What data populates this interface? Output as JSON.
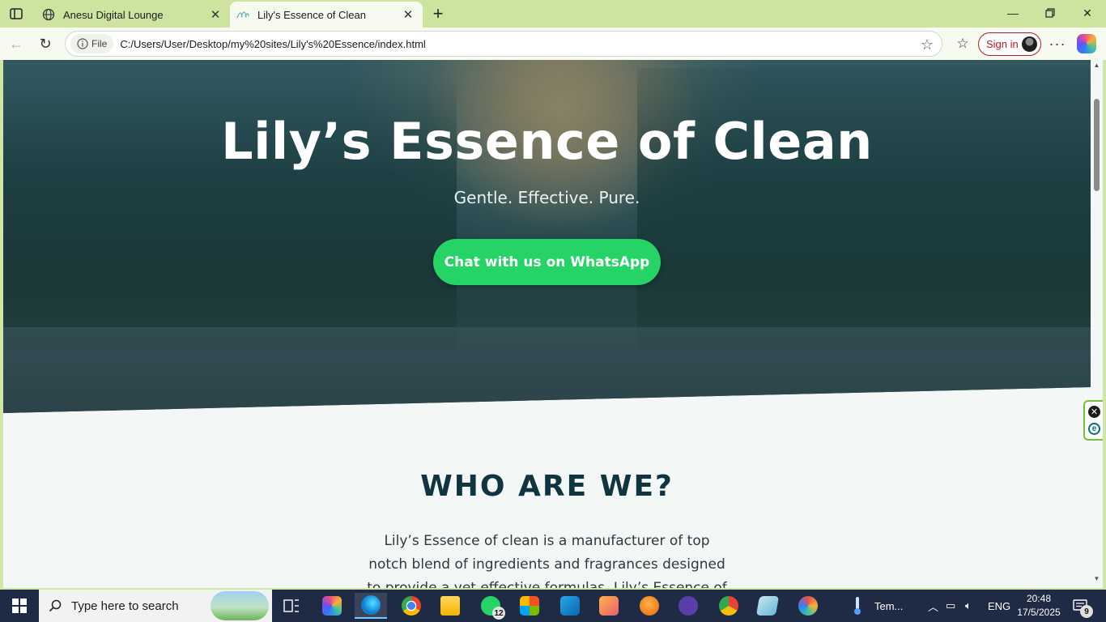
{
  "browser": {
    "tabs": [
      {
        "title": "Anesu Digital Lounge",
        "icon": "globe-icon"
      },
      {
        "title": "Lily's Essence of Clean",
        "icon": "site-favicon"
      }
    ],
    "address": {
      "chip": "File",
      "url": "C:/Users/User/Desktop/my%20sites/Lily's%20Essence/index.html"
    },
    "sign_in_label": "Sign in"
  },
  "page": {
    "hero_title": "Lily’s Essence of Clean",
    "hero_subtitle": "Gentle. Effective. Pure.",
    "cta_label": "Chat with us on WhatsApp",
    "section_title": "WHO ARE WE?",
    "about_text": "Lily’s Essence of clean is a manufacturer of top notch blend of ingredients and fragrances designed to provide a yet effective formulas. Lily’s Essence of Clean products"
  },
  "colors": {
    "cta": "#25d366",
    "section_title": "#123440",
    "browser_frame": "#cde4a1",
    "signin_accent": "#b21d25"
  },
  "taskbar": {
    "search_placeholder": "Type here to search",
    "whatsapp_badge": "12",
    "weather_label": "Tem...",
    "language": "ENG",
    "time": "20:48",
    "date": "17/5/2025",
    "notification_count": "9"
  }
}
